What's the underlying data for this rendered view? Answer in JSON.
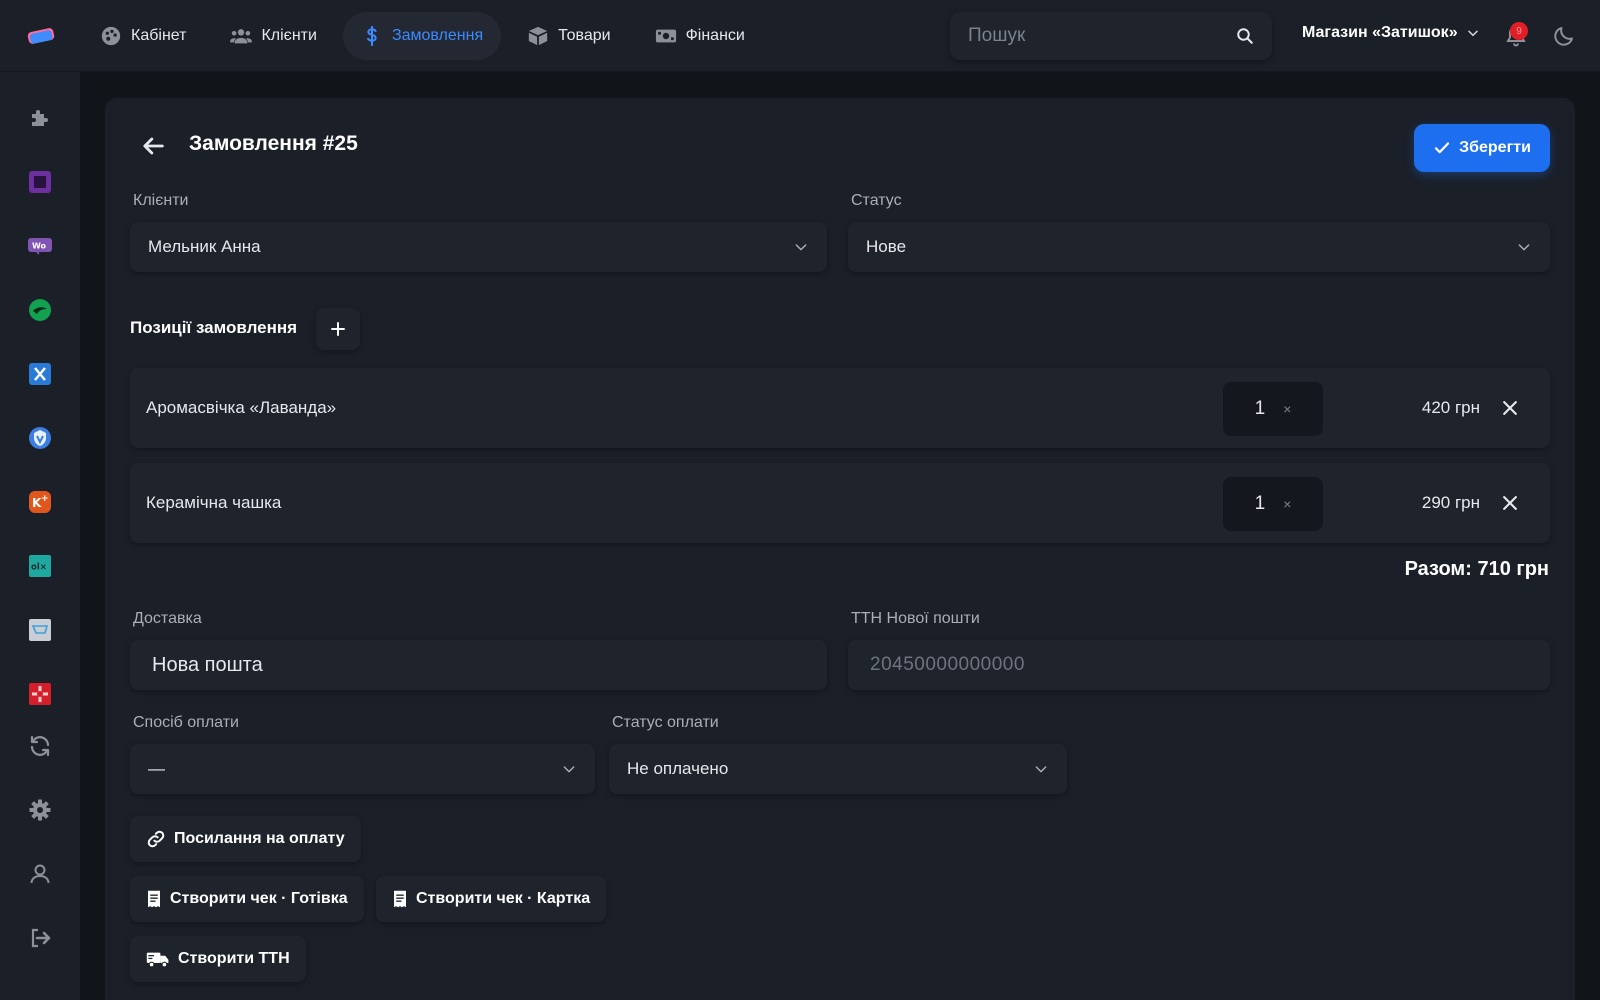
{
  "nav": {
    "items": [
      {
        "label": "Кабінет",
        "icon": "palette-icon"
      },
      {
        "label": "Клієнти",
        "icon": "users-icon"
      },
      {
        "label": "Замовлення",
        "icon": "dollar-icon",
        "active": true
      },
      {
        "label": "Товари",
        "icon": "box-icon"
      },
      {
        "label": "Фінанси",
        "icon": "money-icon"
      }
    ],
    "search_placeholder": "Пошук",
    "store_name": "Магазин «Затишок»",
    "notification_count": "9"
  },
  "sidebar": {
    "items": [
      "puzzle-icon",
      "square-app-icon",
      "woo-icon",
      "green-app-icon",
      "x-app-icon",
      "shield-app-icon",
      "kplus-app-icon",
      "olx-app-icon",
      "cart-app-icon",
      "red-app-icon",
      "sync-icon",
      "gear-icon",
      "user-icon",
      "logout-icon"
    ]
  },
  "order": {
    "title": "Замовлення #25",
    "save_label": "Зберегти",
    "client_label": "Клієнти",
    "client_value": "Мельник Анна",
    "status_label": "Статус",
    "status_value": "Нове",
    "positions_title": "Позиції замовлення",
    "items": [
      {
        "name": "Аромасвічка «Лаванда»",
        "qty": "1",
        "price": "420 грн"
      },
      {
        "name": "Керамічна чашка",
        "qty": "1",
        "price": "290 грн"
      }
    ],
    "qty_separator": "×",
    "total": "Разом: 710 грн",
    "delivery_label": "Доставка",
    "delivery_value": "Нова пошта",
    "ttn_label": "ТТН Нової пошти",
    "ttn_placeholder": "20450000000000",
    "payment_method_label": "Спосіб оплати",
    "payment_method_value": "—",
    "payment_status_label": "Статус оплати",
    "payment_status_value": "Не оплачено",
    "payment_link_label": "Посилання на оплату",
    "receipt_cash_label": "Створити чек · Готівка",
    "receipt_card_label": "Створити чек · Картка",
    "create_ttn_label": "Створити ТТН"
  },
  "colors": {
    "accent": "#1d6ff0",
    "active_nav": "#3b8bff",
    "background": "#111419",
    "panel": "#1b1f28",
    "badge": "#e11d25"
  }
}
